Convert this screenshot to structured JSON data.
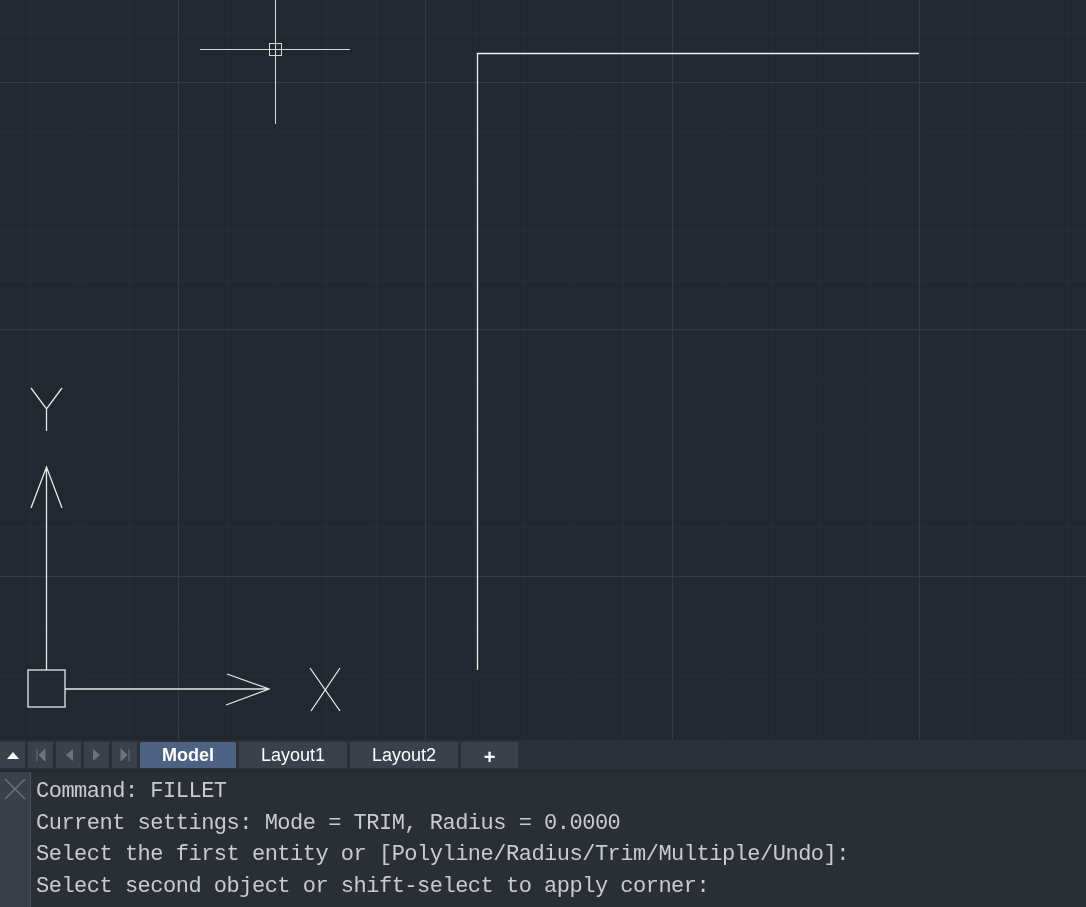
{
  "layout_tabs": [
    {
      "label": "Model",
      "selected": true
    },
    {
      "label": "Layout1",
      "selected": false
    },
    {
      "label": "Layout2",
      "selected": false
    }
  ],
  "new_tab_button": "+",
  "command_history": [
    "Command: FILLET",
    "Current settings: Mode = TRIM, Radius = 0.0000",
    "Select the first entity or [Polyline/Radius/Trim/Multiple/Undo]:",
    "Select second object or shift-select to apply corner:"
  ]
}
